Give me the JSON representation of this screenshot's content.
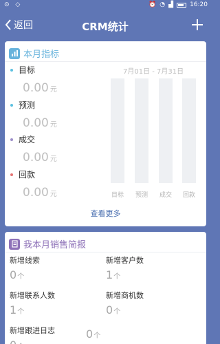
{
  "statusbar": {
    "left_icons": "⊙ ◇",
    "time": "16:20"
  },
  "header": {
    "back_label": "返回",
    "title": "CRM统计"
  },
  "monthly_target": {
    "title": "本月指标",
    "date_range": "7月01日 - 7月31日",
    "metrics": [
      {
        "label": "目标",
        "value": "0.00",
        "unit": "元",
        "color": "#5cc0e0"
      },
      {
        "label": "预测",
        "value": "0.00",
        "unit": "元",
        "color": "#5cc0e0"
      },
      {
        "label": "成交",
        "value": "0.00",
        "unit": "元",
        "color": "#9c8ec8"
      },
      {
        "label": "回款",
        "value": "0.00",
        "unit": "元",
        "color": "#e57373"
      }
    ],
    "bar_labels": [
      "目标",
      "预测",
      "成交",
      "回款"
    ],
    "more_label": "查看更多"
  },
  "sales_brief": {
    "title": "我本月销售简报",
    "stats": [
      {
        "label": "新增线索",
        "value": "0",
        "unit": "个"
      },
      {
        "label": "新增客户数",
        "value": "1",
        "unit": "个"
      },
      {
        "label": "新增联系人数",
        "value": "1",
        "unit": "个"
      },
      {
        "label": "新增商机数",
        "value": "0",
        "unit": "个"
      },
      {
        "label": "新增跟进日志",
        "value": "0",
        "unit": "个"
      },
      {
        "label": "",
        "value": "0",
        "unit": "个"
      }
    ]
  },
  "colors": {
    "primary": "#5f76b5",
    "card1_icon": "#67b3dc",
    "card2_icon": "#8e72b8",
    "link": "#4a6fb0"
  }
}
